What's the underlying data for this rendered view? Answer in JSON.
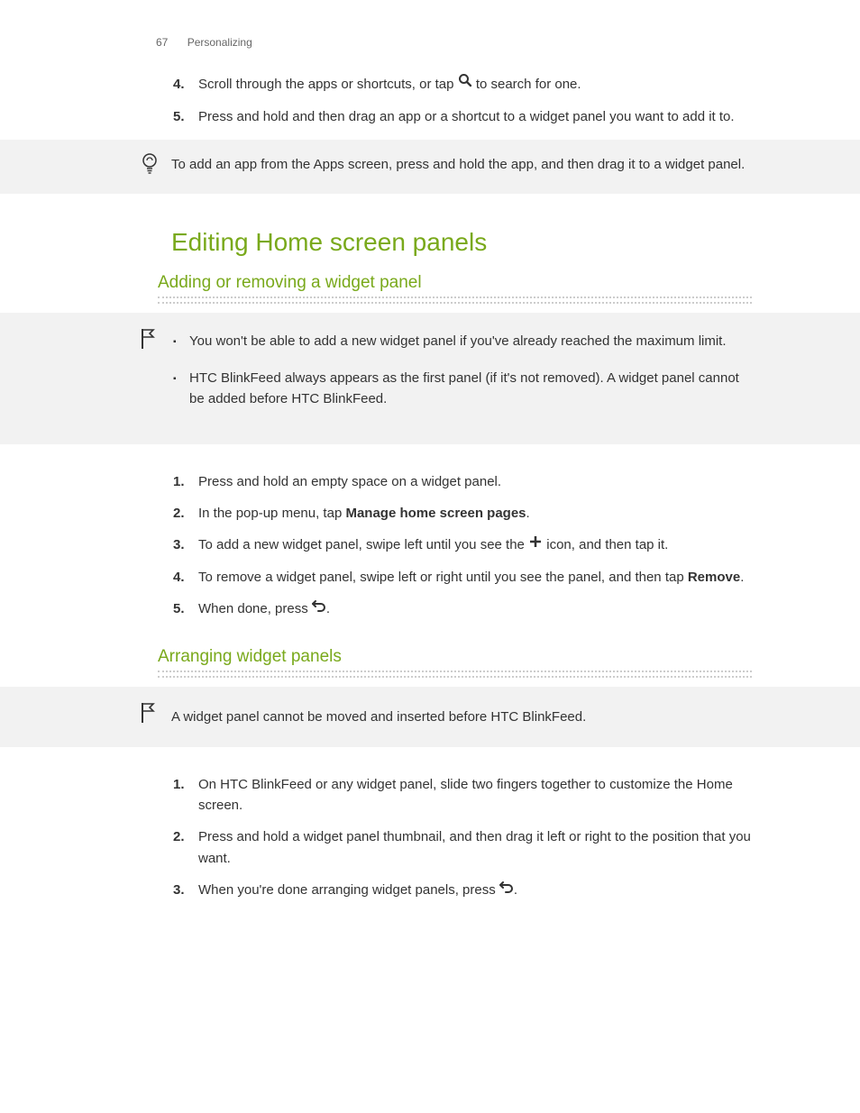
{
  "header": {
    "page_number": "67",
    "section": "Personalizing"
  },
  "intro_list": {
    "start_num": 4,
    "items": [
      {
        "num": "4.",
        "text_pre": "Scroll through the apps or shortcuts, or tap ",
        "icon": "search",
        "text_post": " to search for one."
      },
      {
        "num": "5.",
        "text_pre": "Press and hold and then drag an app or a shortcut to a widget panel you want to add it to.",
        "icon": null,
        "text_post": ""
      }
    ]
  },
  "tip_callout": {
    "text": "To add an app from the Apps screen, press and hold the app, and then drag it to a widget panel."
  },
  "section_title": "Editing Home screen panels",
  "sub1": {
    "title": "Adding or removing a widget panel",
    "flag_bullets": [
      "You won't be able to add a new widget panel if you've already reached the maximum limit.",
      "HTC BlinkFeed always appears as the first panel (if it's not removed). A widget panel cannot be added before HTC BlinkFeed."
    ],
    "steps": [
      {
        "num": "1.",
        "segments": [
          {
            "type": "text",
            "value": "Press and hold an empty space on a widget panel."
          }
        ]
      },
      {
        "num": "2.",
        "segments": [
          {
            "type": "text",
            "value": "In the pop-up menu, tap "
          },
          {
            "type": "bold",
            "value": "Manage home screen pages"
          },
          {
            "type": "text",
            "value": "."
          }
        ]
      },
      {
        "num": "3.",
        "segments": [
          {
            "type": "text",
            "value": "To add a new widget panel, swipe left until you see the "
          },
          {
            "type": "icon",
            "value": "plus"
          },
          {
            "type": "text",
            "value": " icon, and then tap it."
          }
        ]
      },
      {
        "num": "4.",
        "segments": [
          {
            "type": "text",
            "value": "To remove a widget panel, swipe left or right until you see the panel, and then tap "
          },
          {
            "type": "bold",
            "value": "Remove"
          },
          {
            "type": "text",
            "value": "."
          }
        ]
      },
      {
        "num": "5.",
        "segments": [
          {
            "type": "text",
            "value": "When done, press "
          },
          {
            "type": "icon",
            "value": "back"
          },
          {
            "type": "text",
            "value": "."
          }
        ]
      }
    ]
  },
  "sub2": {
    "title": "Arranging widget panels",
    "flag_text": "A widget panel cannot be moved and inserted before HTC BlinkFeed.",
    "steps": [
      {
        "num": "1.",
        "segments": [
          {
            "type": "text",
            "value": "On HTC BlinkFeed or any widget panel, slide two fingers together to customize the Home screen."
          }
        ]
      },
      {
        "num": "2.",
        "segments": [
          {
            "type": "text",
            "value": "Press and hold a widget panel thumbnail, and then drag it left or right to the position that you want."
          }
        ]
      },
      {
        "num": "3.",
        "segments": [
          {
            "type": "text",
            "value": "When you're done arranging widget panels, press "
          },
          {
            "type": "icon",
            "value": "back"
          },
          {
            "type": "text",
            "value": "."
          }
        ]
      }
    ]
  }
}
